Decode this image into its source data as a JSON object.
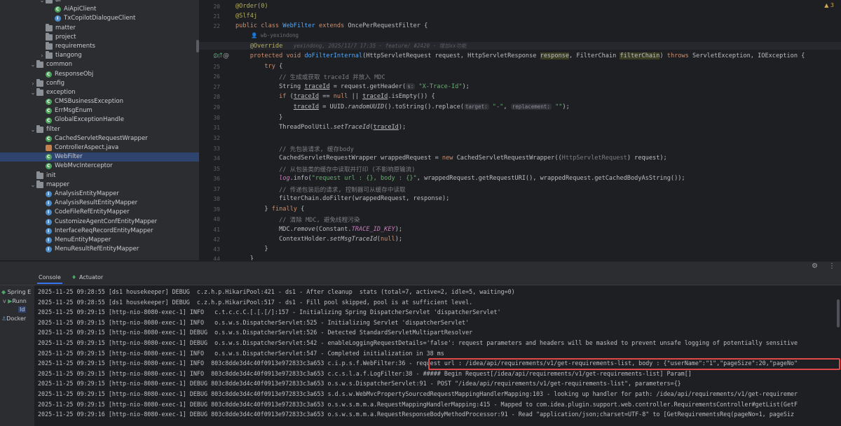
{
  "tree": {
    "rows": [
      {
        "indent": 5,
        "arrow": "v",
        "icon": "folder",
        "label": "ai"
      },
      {
        "indent": 6,
        "arrow": "",
        "icon": "class",
        "label": "AiApiClient"
      },
      {
        "indent": 6,
        "arrow": "",
        "icon": "iface",
        "label": "TxCopilotDialogueClient"
      },
      {
        "indent": 5,
        "arrow": "",
        "icon": "folder",
        "label": "matter"
      },
      {
        "indent": 5,
        "arrow": "",
        "icon": "folder",
        "label": "project"
      },
      {
        "indent": 5,
        "arrow": "",
        "icon": "folder",
        "label": "requirements"
      },
      {
        "indent": 5,
        "arrow": ">",
        "icon": "folder",
        "label": "tiangong"
      },
      {
        "indent": 4,
        "arrow": "v",
        "icon": "folder",
        "label": "common"
      },
      {
        "indent": 5,
        "arrow": "",
        "icon": "class",
        "label": "ResponseObj"
      },
      {
        "indent": 4,
        "arrow": ">",
        "icon": "folder",
        "label": "config"
      },
      {
        "indent": 4,
        "arrow": "v",
        "icon": "folder",
        "label": "exception"
      },
      {
        "indent": 5,
        "arrow": "",
        "icon": "class",
        "label": "CMSBusinessException"
      },
      {
        "indent": 5,
        "arrow": "",
        "icon": "class",
        "label": "ErrMsgEnum"
      },
      {
        "indent": 5,
        "arrow": "",
        "icon": "class",
        "label": "GlobalExceptionHandle"
      },
      {
        "indent": 4,
        "arrow": "v",
        "icon": "folder",
        "label": "filter"
      },
      {
        "indent": 5,
        "arrow": "",
        "icon": "class",
        "label": "CachedServletRequestWrapper"
      },
      {
        "indent": 5,
        "arrow": "",
        "icon": "java",
        "label": "ControllerAspect.java"
      },
      {
        "indent": 5,
        "arrow": "",
        "icon": "class",
        "label": "WebFilter",
        "selected": true
      },
      {
        "indent": 5,
        "arrow": "",
        "icon": "class",
        "label": "WebMvcInterceptor"
      },
      {
        "indent": 4,
        "arrow": "",
        "icon": "folder",
        "label": "init"
      },
      {
        "indent": 4,
        "arrow": "v",
        "icon": "folder",
        "label": "mapper"
      },
      {
        "indent": 5,
        "arrow": "",
        "icon": "iface",
        "label": "AnalysisEntityMapper"
      },
      {
        "indent": 5,
        "arrow": "",
        "icon": "iface",
        "label": "AnalysisResultEntityMapper"
      },
      {
        "indent": 5,
        "arrow": "",
        "icon": "iface",
        "label": "CodeFileRefEntityMapper"
      },
      {
        "indent": 5,
        "arrow": "",
        "icon": "iface",
        "label": "CustomizeAgentConfEntityMapper"
      },
      {
        "indent": 5,
        "arrow": "",
        "icon": "iface",
        "label": "InterfaceReqRecordEntityMapper"
      },
      {
        "indent": 5,
        "arrow": "",
        "icon": "iface",
        "label": "MenuEntityMapper"
      },
      {
        "indent": 5,
        "arrow": "",
        "icon": "iface",
        "label": "MenuResultRefEntityMapper"
      }
    ]
  },
  "editor": {
    "warning_count": "3",
    "author_hint": "wb-yexindong",
    "blame": "yexindong, 2025/11/7 17:35 · feature/ #2420 · 增加xx功能",
    "line_numbers": [
      "20",
      "21",
      "22",
      "",
      "23",
      "24",
      "25",
      "26",
      "27",
      "28",
      "29",
      "30",
      "31",
      "32",
      "33",
      "34",
      "35",
      "36",
      "37",
      "38",
      "39",
      "40",
      "41",
      "42",
      "43",
      "44"
    ],
    "hints": {
      "name": "s:",
      "target": "target:",
      "replacement": "replacement:"
    },
    "code": {
      "order": "@Order(0)",
      "slf4j": "@Slf4j",
      "class_kw": "public class ",
      "class_name": "WebFilter",
      "extends_kw": " extends ",
      "super_name": "OncePerRequestFilter {",
      "override": "@Override",
      "method_kw": "protected void ",
      "method_name": "doFilterInternal",
      "method_params_a": "(HttpServletRequest request, HttpServletResponse ",
      "param_response": "response",
      "method_params_b": ", FilterChain ",
      "param_chain": "filterChain",
      "method_params_c": ") ",
      "throws_kw": "throws",
      "method_params_d": " ServletException, IOException {",
      "try_kw": "try",
      "try_rest": " {",
      "c1": "// 生成或获取 traceId 并放入 MDC",
      "l25a": "String ",
      "l25b": "traceId",
      "l25c": " = request.getHeader(",
      "l25d": "\"X-Trace-Id\"",
      "l25e": ");",
      "l26a": "if",
      "l26b": " (",
      "l26c": "traceId",
      "l26d": " == ",
      "l26e": "null",
      "l26f": " || ",
      "l26g": "traceId",
      "l26h": ".isEmpty()) {",
      "l27a": "traceId",
      "l27b": " = UUID.",
      "l27c": "randomUUID",
      "l27d": "().toString().replace(",
      "l27e": "\"-\"",
      "l27f": ", ",
      "l27g": "\"\"",
      "l27h": ");",
      "l28": "}",
      "l29a": "ThreadPoolUtil.",
      "l29b": "setTraceId",
      "l29c": "(",
      "l29d": "traceId",
      "l29e": ");",
      "c2": "// 先包装请求, 缓存body",
      "l32a": "CachedServletRequestWrapper wrappedRequest = ",
      "l32b": "new",
      "l32c": " CachedServletRequestWrapper((",
      "l32d": "HttpServletRequest",
      "l32e": ") request);",
      "c3": "// 从包装类的缓存中读取并打印 (不影响原输流)",
      "l34a": "log",
      "l34b": ".info(",
      "l34c": "\"request url : {}, body : {}\"",
      "l34d": ", wrappedRequest.getRequestURI(), wrappedRequest.getCachedBodyAsString());",
      "c4": "// 传递包装后的请求, 控制器可从缓存中读取",
      "l36": "filterChain.doFilter(wrappedRequest, response);",
      "l37a": "} ",
      "l37b": "finally",
      "l37c": " {",
      "c5": "// 清除 MDC, 避免线程污染",
      "l39a": "MDC.",
      "l39b": "remove",
      "l39c": "(Constant.",
      "l39d": "TRACE_ID_KEY",
      "l39e": ");",
      "l40a": "ContextHolder.",
      "l40b": "setMsgTraceId",
      "l40c": "(",
      "l40d": "null",
      "l40e": ");",
      "l41": "}",
      "l42": "}"
    }
  },
  "panel": {
    "tabs": [
      "Console",
      "Actuator"
    ],
    "run_tree": [
      "Spring E",
      "Runn",
      "Id",
      "Docker"
    ],
    "log_lines": [
      "2025-11-25 09:28:55 [ds1 housekeeper] DEBUG  c.z.h.p.HikariPool:421 - ds1 - After cleanup  stats (total=7, active=2, idle=5, waiting=0)",
      "2025-11-25 09:28:55 [ds1 housekeeper] DEBUG  c.z.h.p.HikariPool:517 - ds1 - Fill pool skipped, pool is at sufficient level.",
      "2025-11-25 09:29:15 [http-nio-8080-exec-1] INFO   c.t.c.c.C.[.[.[/]:157 - Initializing Spring DispatcherServlet 'dispatcherServlet'",
      "2025-11-25 09:29:15 [http-nio-8080-exec-1] INFO   o.s.w.s.DispatcherServlet:525 - Initializing Servlet 'dispatcherServlet'",
      "2025-11-25 09:29:15 [http-nio-8080-exec-1] DEBUG  o.s.w.s.DispatcherServlet:526 - Detected StandardServletMultipartResolver",
      "2025-11-25 09:29:15 [http-nio-8080-exec-1] DEBUG  o.s.w.s.DispatcherServlet:542 - enableLoggingRequestDetails='false': request parameters and headers will be masked to prevent unsafe logging of potentially sensitive",
      "2025-11-25 09:29:15 [http-nio-8080-exec-1] INFO   o.s.w.s.DispatcherServlet:547 - Completed initialization in 38 ms",
      "2025-11-25 09:29:15 [http-nio-8080-exec-1] INFO  803c8dde3d4c40f0913e972833c3a653 c.i.p.s.f.WebFilter:36 - request url : /idea/api/requirements/v1/get-requirements-list, body : {\"userName\":\"1\",\"pageSize\":20,\"pageNo\"",
      "2025-11-25 09:29:15 [http-nio-8080-exec-1] INFO  803c8dde3d4c40f0913e972833c3a653 c.c.s.l.a.f.LogFilter:38 - ##### Begin Request[/idea/api/requirements/v1/get-requirements-list] Param[]",
      "2025-11-25 09:29:15 [http-nio-8080-exec-1] DEBUG 803c8dde3d4c40f0913e972833c3a653 o.s.w.s.DispatcherServlet:91 - POST \"/idea/api/requirements/v1/get-requirements-list\", parameters={}",
      "2025-11-25 09:29:15 [http-nio-8080-exec-1] DEBUG 803c8dde3d4c40f0913e972833c3a653 s.d.s.w.WebMvcPropertySourcedRequestMappingHandlerMapping:103 - looking up handler for path: /idea/api/requirements/v1/get-requiremer",
      "2025-11-25 09:29:15 [http-nio-8080-exec-1] DEBUG 803c8dde3d4c40f0913e972833c3a653 o.s.w.s.m.m.a.RequestMappingHandlerMapping:415 - Mapped to com.idea.plugin.support.web.controller.RequirementsController#getList(GetF",
      "2025-11-25 09:29:16 [http-nio-8080-exec-1] DEBUG 803c8dde3d4c40f0913e972833c3a653 o.s.w.s.m.m.a.RequestResponseBodyMethodProcessor:91 - Read \"application/json;charset=UTF-8\" to [GetRequirementsReq(pageNo=1, pageSiz"
    ]
  }
}
